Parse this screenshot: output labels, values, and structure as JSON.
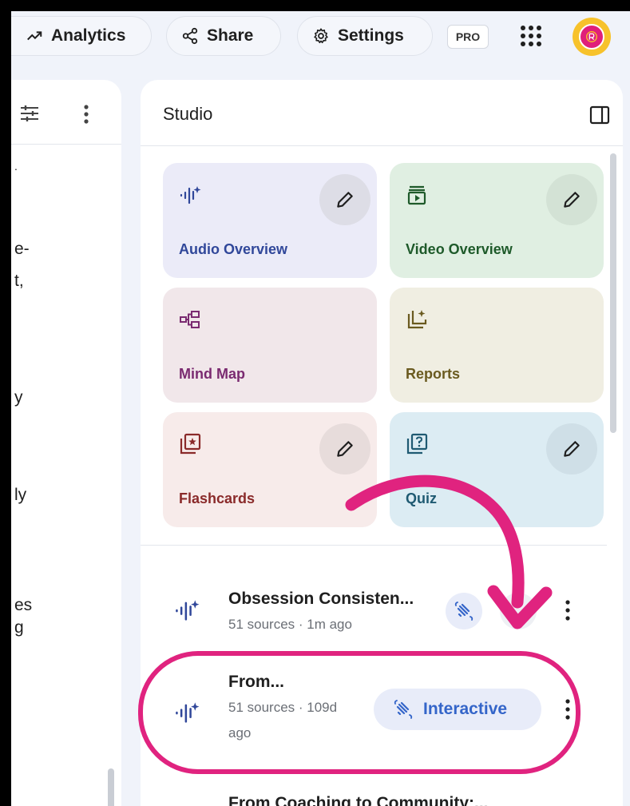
{
  "topbar": {
    "analytics_label": "Analytics",
    "share_label": "Share",
    "settings_label": "Settings",
    "pro_badge": "PRO"
  },
  "left_panel": {
    "fragments": [
      "e-",
      "t,",
      "y",
      "ly",
      "es",
      "g"
    ]
  },
  "studio": {
    "title": "Studio",
    "cards": [
      {
        "label": "Audio Overview",
        "color": "#30479a",
        "bg": "#ebebf8"
      },
      {
        "label": "Video Overview",
        "color": "#1e5a2a",
        "bg": "#e0efe2"
      },
      {
        "label": "Mind Map",
        "color": "#7a2a70",
        "bg": "#f1e7ea"
      },
      {
        "label": "Reports",
        "color": "#6a5a1f",
        "bg": "#f0eee2"
      },
      {
        "label": "Flashcards",
        "color": "#8a2a2a",
        "bg": "#f7ebea"
      },
      {
        "label": "Quiz",
        "color": "#1f5a72",
        "bg": "#dcecf3"
      }
    ],
    "items": [
      {
        "title": "Obsession Consisten...",
        "meta": "51 sources · 1m ago"
      },
      {
        "title": "From...",
        "meta_line1": "51 sources · 109d",
        "meta_line2": "ago",
        "button_label": "Interactive"
      },
      {
        "title": "From Coaching to Community:..."
      }
    ]
  },
  "colors": {
    "accent_pink": "#e0237f",
    "interactive_blue": "#3465c9"
  }
}
